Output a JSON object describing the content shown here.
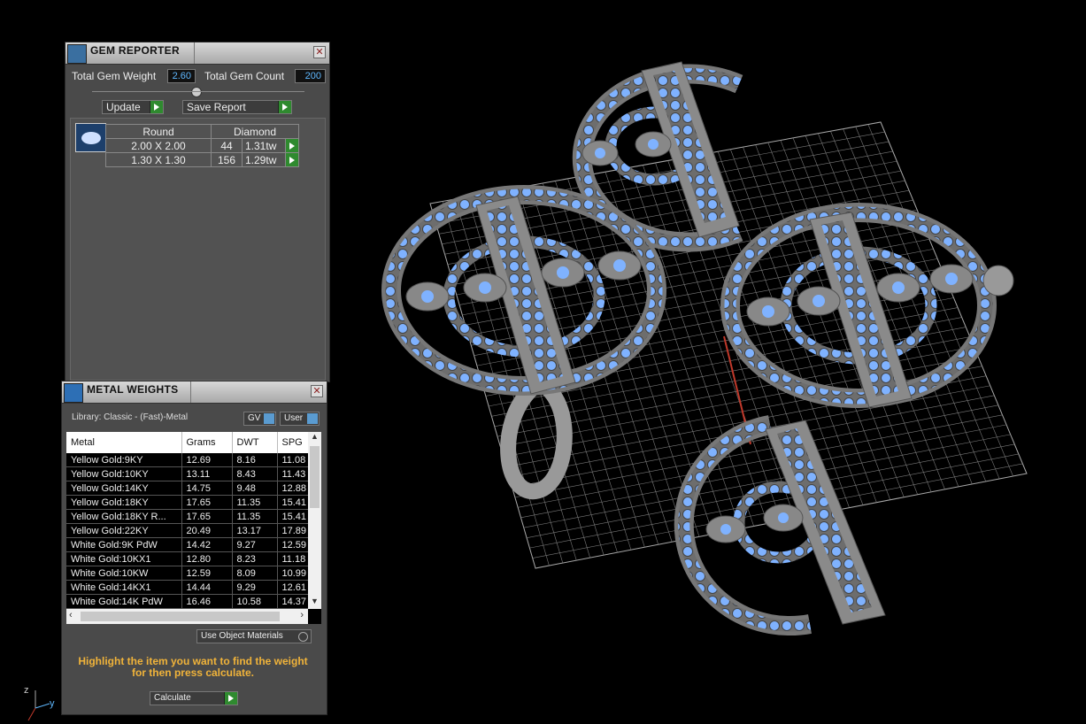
{
  "gem_reporter": {
    "title": "GEM REPORTER",
    "close": "✕",
    "total_weight_label": "Total Gem Weight",
    "total_weight_value": "2.60",
    "total_count_label": "Total Gem Count",
    "total_count_value": "200",
    "update_label": "Update",
    "save_report_label": "Save Report",
    "table_header": {
      "shape": "Round",
      "material": "Diamond"
    },
    "rows": [
      {
        "size": "2.00 X 2.00",
        "count": "44",
        "weight": "1.31tw"
      },
      {
        "size": "1.30 X 1.30",
        "count": "156",
        "weight": "1.29tw"
      }
    ]
  },
  "metal_weights": {
    "title": "METAL WEIGHTS",
    "close": "✕",
    "library_label": "Library: Classic - (Fast)-Metal",
    "gv_label": "GV",
    "user_label": "User",
    "columns": [
      "Metal",
      "Grams",
      "DWT",
      "SPG"
    ],
    "rows": [
      [
        "Yellow Gold:9KY",
        "12.69",
        "8.16",
        "11.08"
      ],
      [
        "Yellow Gold:10KY",
        "13.11",
        "8.43",
        "11.43"
      ],
      [
        "Yellow Gold:14KY",
        "14.75",
        "9.48",
        "12.88"
      ],
      [
        "Yellow Gold:18KY",
        "17.65",
        "11.35",
        "15.41"
      ],
      [
        "Yellow Gold:18KY R...",
        "17.65",
        "11.35",
        "15.41"
      ],
      [
        "Yellow Gold:22KY",
        "20.49",
        "13.17",
        "17.89"
      ],
      [
        "White Gold:9K PdW",
        "14.42",
        "9.27",
        "12.59"
      ],
      [
        "White Gold:10KX1",
        "12.80",
        "8.23",
        "11.18"
      ],
      [
        "White Gold:10KW",
        "12.59",
        "8.09",
        "10.99"
      ],
      [
        "White Gold:14KX1",
        "14.44",
        "9.29",
        "12.61"
      ],
      [
        "White Gold:14K PdW",
        "16.46",
        "10.58",
        "14.37"
      ]
    ],
    "use_object_materials_label": "Use Object Materials",
    "note_line1": "Highlight the item you want to find the weight",
    "note_line2": "for then press calculate.",
    "calculate_label": "Calculate"
  },
  "viewport": {
    "axis_z": "z",
    "axis_y": "y"
  },
  "colors": {
    "gem_blue": "#7fb2ff",
    "metal_grey": "#8c8c8c",
    "note_orange": "#f0b33a",
    "value_blue": "#5fb8ff"
  }
}
